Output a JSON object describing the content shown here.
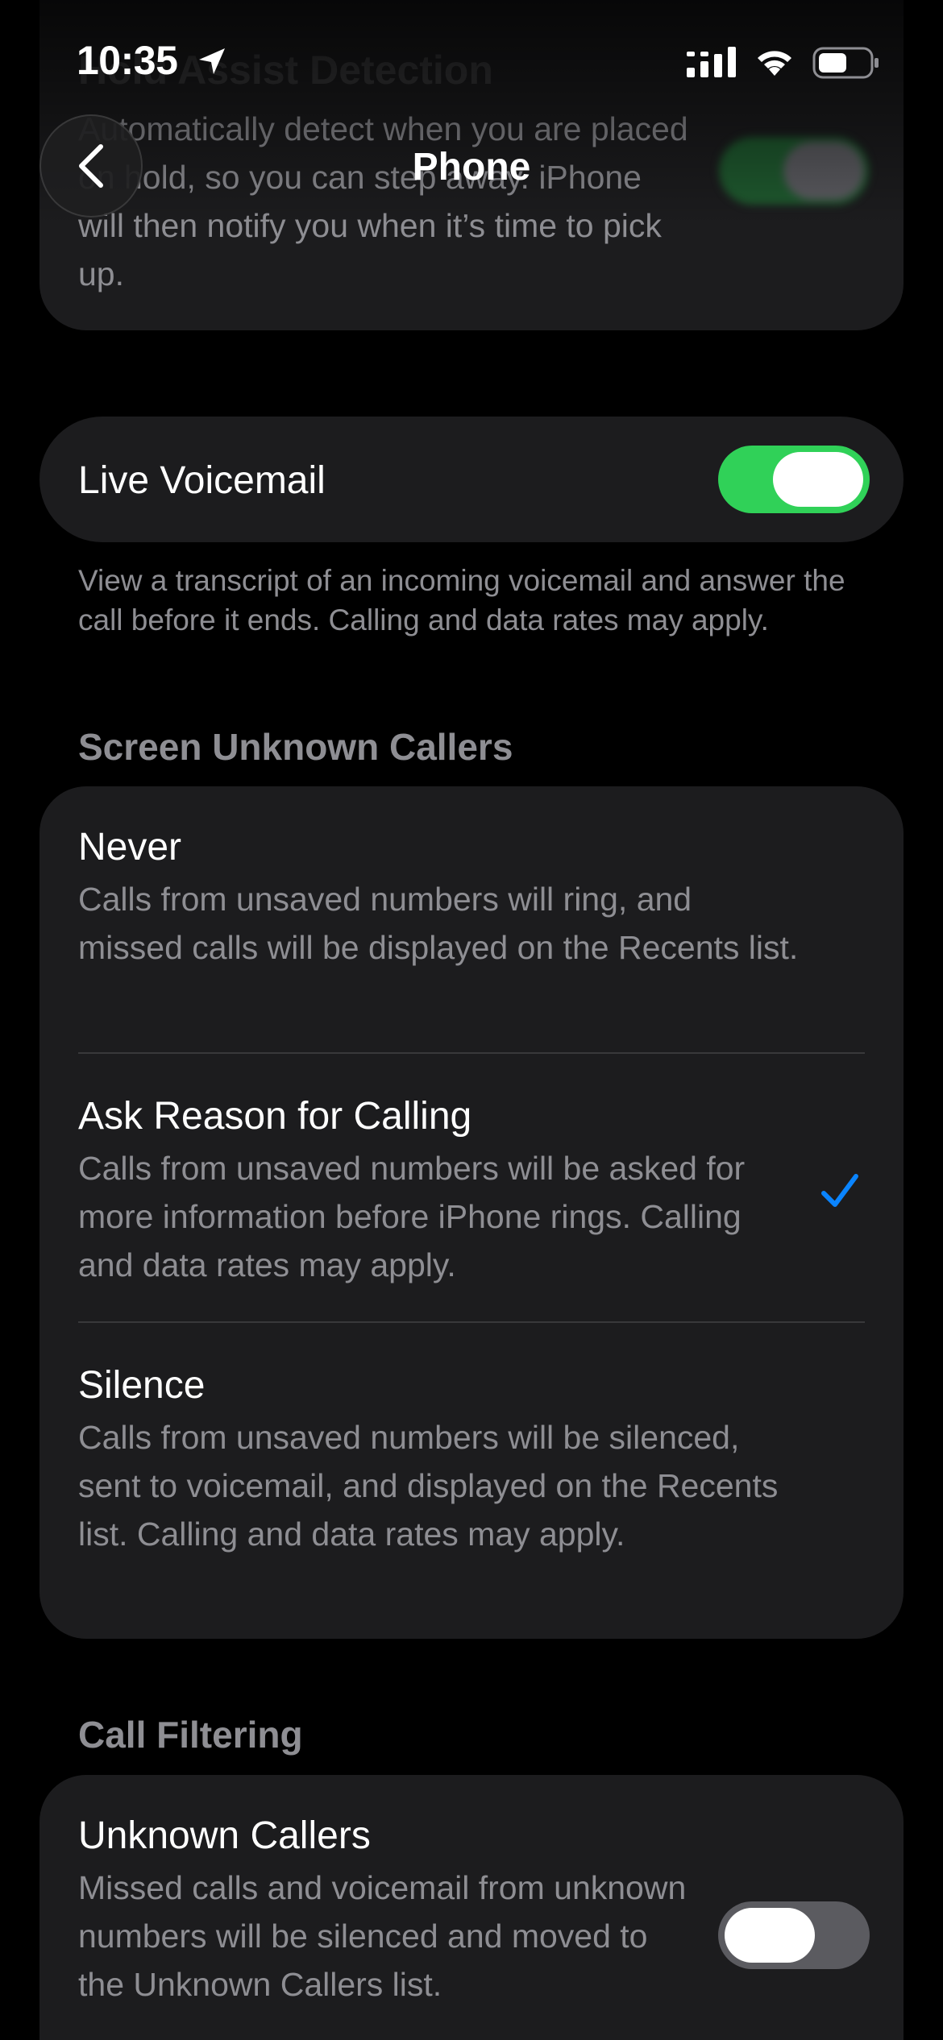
{
  "status_bar": {
    "time": "10:35",
    "icons": [
      "location-arrow-icon",
      "cellular-signal-icon",
      "wifi-icon",
      "battery-icon"
    ]
  },
  "nav": {
    "title": "Phone",
    "back_icon": "chevron-left-icon"
  },
  "hold_assist": {
    "title": "Hold Assist Detection",
    "description": "Automatically detect when you are placed on hold, so you can step away. iPhone will then notify you when it’s time to pick up.",
    "enabled": true
  },
  "live_voicemail": {
    "label": "Live Voicemail",
    "enabled": true,
    "footer": "View a transcript of an incoming voicemail and answer the call before it ends. Calling and data rates may apply."
  },
  "screen_unknown_callers": {
    "header": "Screen Unknown Callers",
    "options": [
      {
        "title": "Never",
        "description": "Calls from unsaved numbers will ring, and missed calls will be displayed on the Recents list.",
        "selected": false
      },
      {
        "title": "Ask Reason for Calling",
        "description": "Calls from unsaved numbers will be asked for more information before iPhone rings. Calling and data rates may apply.",
        "selected": true
      },
      {
        "title": "Silence",
        "description": "Calls from unsaved numbers will be silenced, sent to voicemail, and displayed on the Recents list. Calling and data rates may apply.",
        "selected": false
      }
    ]
  },
  "call_filtering": {
    "header": "Call Filtering",
    "unknown_callers": {
      "title": "Unknown Callers",
      "description": "Missed calls and voicemail from unknown numbers will be silenced and moved to the Unknown Callers list.",
      "enabled": false
    }
  },
  "colors": {
    "background": "#000000",
    "card": "#1c1c1e",
    "toggle_on": "#30d158",
    "toggle_off": "#5b5b60",
    "accent_blue": "#0a84ff",
    "secondary_text": "#8e8e93",
    "separator": "#38383a"
  }
}
